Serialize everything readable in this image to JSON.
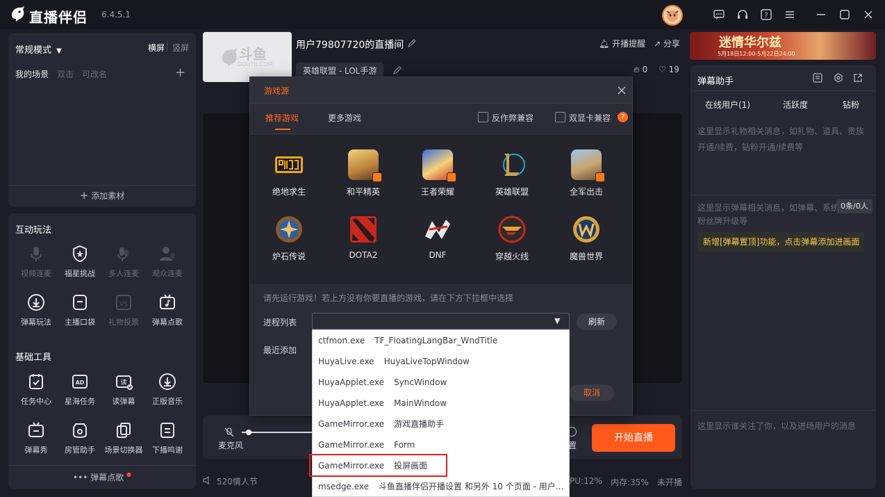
{
  "titlebar": {
    "app_name": "直播伴侣",
    "version": "6.4.5.1"
  },
  "scene_panel": {
    "mode_label": "常规模式",
    "orient_landscape": "横屏",
    "orient_portrait": "竖屏",
    "my_scenes": "我的场景",
    "hint_dblclick": "双击",
    "hint_rename": "可改名",
    "add_material": "添加素材"
  },
  "interact": {
    "title": "互动玩法",
    "row1": [
      "视频连麦",
      "福星挑战",
      "多人连麦",
      "观众连麦"
    ],
    "row2": [
      "弹幕玩法",
      "主播口袋",
      "礼物投票",
      "弹幕点歌"
    ]
  },
  "basic_tools": {
    "title": "基础工具",
    "row1": [
      "任务中心",
      "星海任务",
      "读弹幕",
      "正版音乐"
    ],
    "row2": [
      "弹幕秀",
      "房管助手",
      "场景切换器",
      "下播鸣谢"
    ],
    "footer": "弹幕点歌"
  },
  "room": {
    "thumb_brand": "斗鱼",
    "thumb_domain": "DOUYU.COM",
    "title": "用户79807720的直播间",
    "category": "英雄联盟 - LOL手游",
    "remind": "开播提醒",
    "share": "分享",
    "hot_count": "0",
    "like_count": "19"
  },
  "bottom_bar": {
    "mic_label": "麦克风",
    "settings_label_fragment": "置",
    "start_button": "开始直播"
  },
  "status_bar": {
    "music": "520情人节",
    "cpu": "PU:12%",
    "memory": "内存:35%",
    "state": "未开播"
  },
  "promo": {
    "title": "迷情华尔兹",
    "dates": "5月18日12:00-5月22日24:00"
  },
  "danmu": {
    "title": "弹幕助手",
    "tabs": [
      "在线用户(1)",
      "活跃度",
      "钻粉"
    ],
    "gift_hint": "这里显示礼物相关消息，如礼物、道具、贵族开通/续费，钻粉开通/续费等",
    "danmu_hint": "这里显示弹幕相关消息，如弹幕、系统",
    "danmu_hint2": "粉丝牌升级等",
    "count_badge": "0条/0人",
    "new_feature": "新增[弹幕置顶]功能，点击弹幕添加进画面",
    "follow_hint": "这里显示谁关注了你，以及进场用户的消息"
  },
  "dialog": {
    "title": "游戏源",
    "tab_recommended": "推荐游戏",
    "tab_more": "更多游戏",
    "anti_cheat": "反作弊兼容",
    "dual_gpu": "双显卡兼容",
    "help": "?",
    "games": [
      "绝地求生",
      "和平精英",
      "王者荣耀",
      "英雄联盟",
      "全军出击",
      "炉石传说",
      "DOTA2",
      "DNF",
      "穿越火线",
      "魔兽世界"
    ],
    "hint": "请先运行游戏！若上方没有你要直播的游戏，请在下方下拉框中选择",
    "process_label": "进程列表",
    "recent_label": "最近添加",
    "refresh": "刷新",
    "cancel": "取消"
  },
  "process_list": [
    {
      "exe": "ctfmon.exe",
      "window": "TF_FloatingLangBar_WndTitle"
    },
    {
      "exe": "HuyaLive.exe",
      "window": "HuyaLiveTopWindow"
    },
    {
      "exe": "HuyaApplet.exe",
      "window": "SyncWindow"
    },
    {
      "exe": "HuyaApplet.exe",
      "window": "MainWindow"
    },
    {
      "exe": "GameMirror.exe",
      "window": "游戏直播助手"
    },
    {
      "exe": "GameMirror.exe",
      "window": "Form"
    },
    {
      "exe": "GameMirror.exe",
      "window": "投屏画面"
    },
    {
      "exe": "msedge.exe",
      "window": "斗鱼直播伴侣开播设置 和另外 10 个页面 - 用户..."
    }
  ],
  "colors": {
    "accent": "#ff5a1c",
    "dialog_accent": "#ff6a22",
    "highlight_box": "#e01f1f"
  }
}
